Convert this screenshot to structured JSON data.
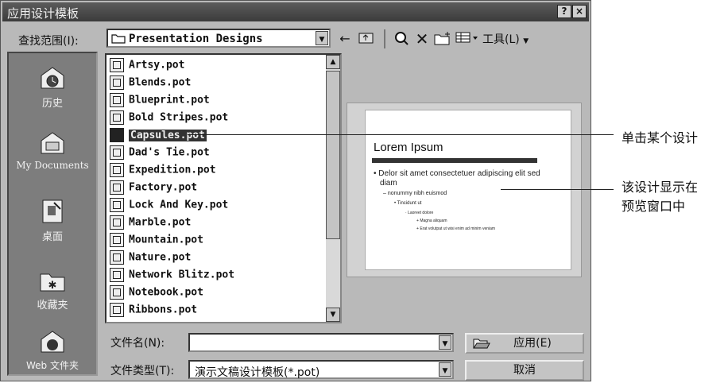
{
  "dialog": {
    "title": "应用设计模板",
    "help_label": "?",
    "close_label": "×"
  },
  "lookin": {
    "label": "查找范围(I):",
    "value": "Presentation Designs"
  },
  "toolbar": {
    "tools_label": "工具(L)"
  },
  "places": [
    {
      "label": "历史",
      "icon": "history-icon"
    },
    {
      "label": "My Documents",
      "icon": "my-documents-icon"
    },
    {
      "label": "桌面",
      "icon": "desktop-icon"
    },
    {
      "label": "收藏夹",
      "icon": "favorites-icon"
    },
    {
      "label": "Web 文件夹",
      "icon": "web-folders-icon"
    }
  ],
  "files": [
    "Artsy.pot",
    "Blends.pot",
    "Blueprint.pot",
    "Bold Stripes.pot",
    "Capsules.pot",
    "Dad's Tie.pot",
    "Expedition.pot",
    "Factory.pot",
    "Lock And Key.pot",
    "Marble.pot",
    "Mountain.pot",
    "Nature.pot",
    "Network Blitz.pot",
    "Notebook.pot",
    "Ribbons.pot"
  ],
  "selected_file": "Capsules.pot",
  "preview": {
    "title": "Lorem Ipsum",
    "bullet1": "Delor sit amet consectetuer adipiscing elit sed",
    "bullet1b": "diam",
    "sub1": "nonummy nibh euismod",
    "sub2": "Tincidunt ut",
    "sub3": "Laoreet dolore",
    "sub4": "Magna aliquam",
    "sub5": "Erat volutpat ut wisi enim ad minim veniam"
  },
  "filename": {
    "label": "文件名(N):",
    "value": ""
  },
  "filetype": {
    "label": "文件类型(T):",
    "value": "演示文稿设计模板(*.pot)"
  },
  "buttons": {
    "apply": "应用(E)",
    "cancel": "取消"
  },
  "callouts": {
    "click_design": "单击某个设计",
    "shown_line1": "该设计显示在",
    "shown_line2": "预览窗口中"
  }
}
